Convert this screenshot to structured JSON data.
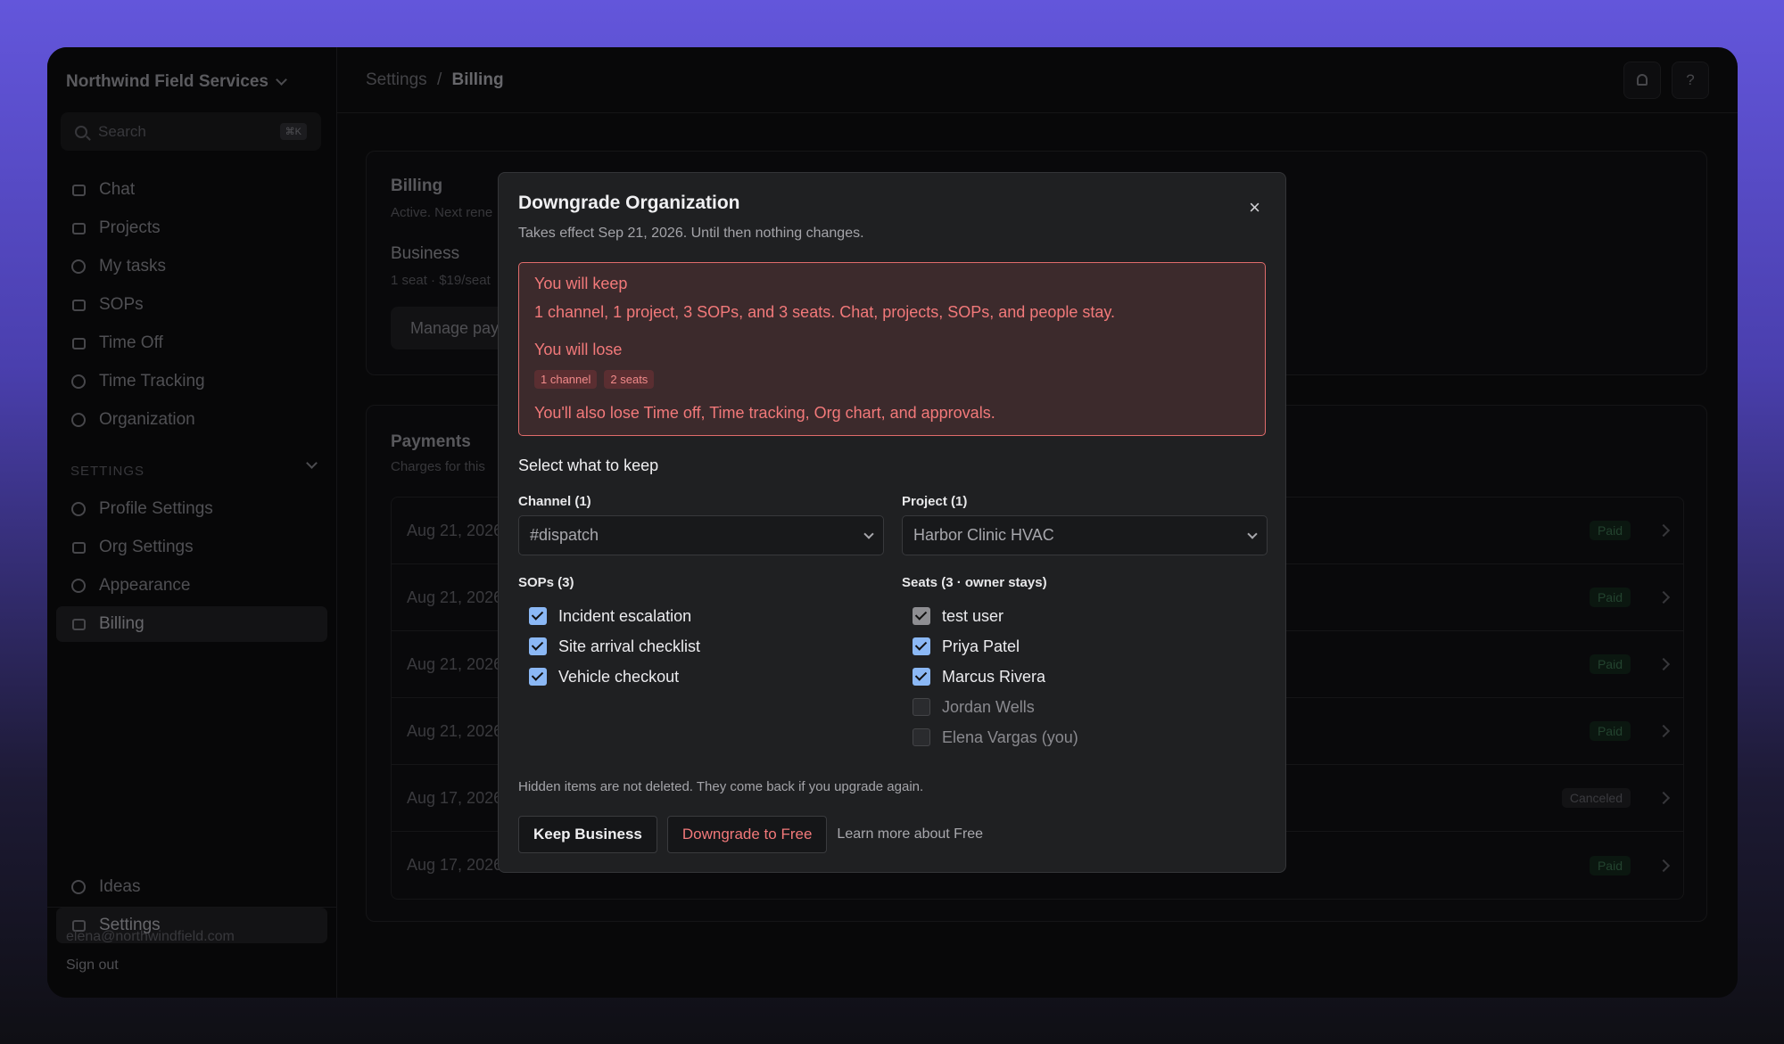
{
  "sidebar": {
    "org_name": "Northwind Field Services",
    "search_placeholder": "Search",
    "search_shortcut": "⌘K",
    "nav": [
      {
        "label": "Chat",
        "icon": "chat-icon"
      },
      {
        "label": "Projects",
        "icon": "columns-icon"
      },
      {
        "label": "My tasks",
        "icon": "check-circle-icon"
      },
      {
        "label": "SOPs",
        "icon": "document-icon"
      },
      {
        "label": "Time Off",
        "icon": "calendar-icon"
      },
      {
        "label": "Time Tracking",
        "icon": "stopwatch-icon"
      },
      {
        "label": "Organization",
        "icon": "people-icon"
      }
    ],
    "settings_label": "SETTINGS",
    "settings_nav": [
      {
        "label": "Profile Settings",
        "icon": "user-icon"
      },
      {
        "label": "Org Settings",
        "icon": "list-icon"
      },
      {
        "label": "Appearance",
        "icon": "contrast-icon"
      },
      {
        "label": "Billing",
        "icon": "card-icon"
      }
    ],
    "bottom_nav": [
      {
        "label": "Ideas",
        "icon": "lightbulb-icon"
      },
      {
        "label": "Settings",
        "icon": "sliders-icon"
      }
    ],
    "email": "elena@northwindfield.com",
    "sign_out": "Sign out"
  },
  "topbar": {
    "crumb_parent": "Settings",
    "crumb_sep": "/",
    "crumb_current": "Billing",
    "help_label": "?"
  },
  "billing_card": {
    "title": "Billing",
    "status": "Active. Next rene",
    "plan": "Business",
    "plan_detail": "1 seat · $19/seat",
    "manage_button": "Manage pay"
  },
  "payments_card": {
    "title": "Payments",
    "subtitle": "Charges for this",
    "rows": [
      {
        "date": "Aug 21, 2026",
        "status": "Paid"
      },
      {
        "date": "Aug 21, 2026",
        "status": "Paid"
      },
      {
        "date": "Aug 21, 2026",
        "status": "Paid"
      },
      {
        "date": "Aug 21, 2026",
        "status": "Paid"
      },
      {
        "date": "Aug 17, 2026",
        "status": "Canceled"
      },
      {
        "date": "Aug 17, 2026",
        "status": "Paid"
      }
    ]
  },
  "modal": {
    "title": "Downgrade Organization",
    "subtitle": "Takes effect Sep 21, 2026. Until then nothing changes.",
    "close": "×",
    "keep_heading": "You will keep",
    "keep_detail": "1 channel, 1 project, 3 SOPs, and 3 seats. Chat, projects, SOPs, and people stay.",
    "lose_heading": "You will lose",
    "lose_tags": [
      "1 channel",
      "2 seats"
    ],
    "lose_detail": "You'll also lose Time off, Time tracking, Org chart, and approvals.",
    "select_title": "Select what to keep",
    "channel_label": "Channel (1)",
    "channel_value": "#dispatch",
    "project_label": "Project (1)",
    "project_value": "Harbor Clinic HVAC",
    "sops_label": "SOPs (3)",
    "sops": [
      {
        "label": "Incident escalation",
        "checked": true
      },
      {
        "label": "Site arrival checklist",
        "checked": true
      },
      {
        "label": "Vehicle checkout",
        "checked": true
      }
    ],
    "seats_label": "Seats (3 · owner stays)",
    "seats": [
      {
        "label": "test user",
        "checked": true,
        "locked": true
      },
      {
        "label": "Priya Patel",
        "checked": true
      },
      {
        "label": "Marcus Rivera",
        "checked": true
      },
      {
        "label": "Jordan Wells",
        "checked": false
      },
      {
        "label": "Elena Vargas (you)",
        "checked": false
      }
    ],
    "note": "Hidden items are not deleted. They come back if you upgrade again.",
    "keep_button": "Keep Business",
    "downgrade_button": "Downgrade to Free",
    "learn_more": "Learn more about Free"
  }
}
